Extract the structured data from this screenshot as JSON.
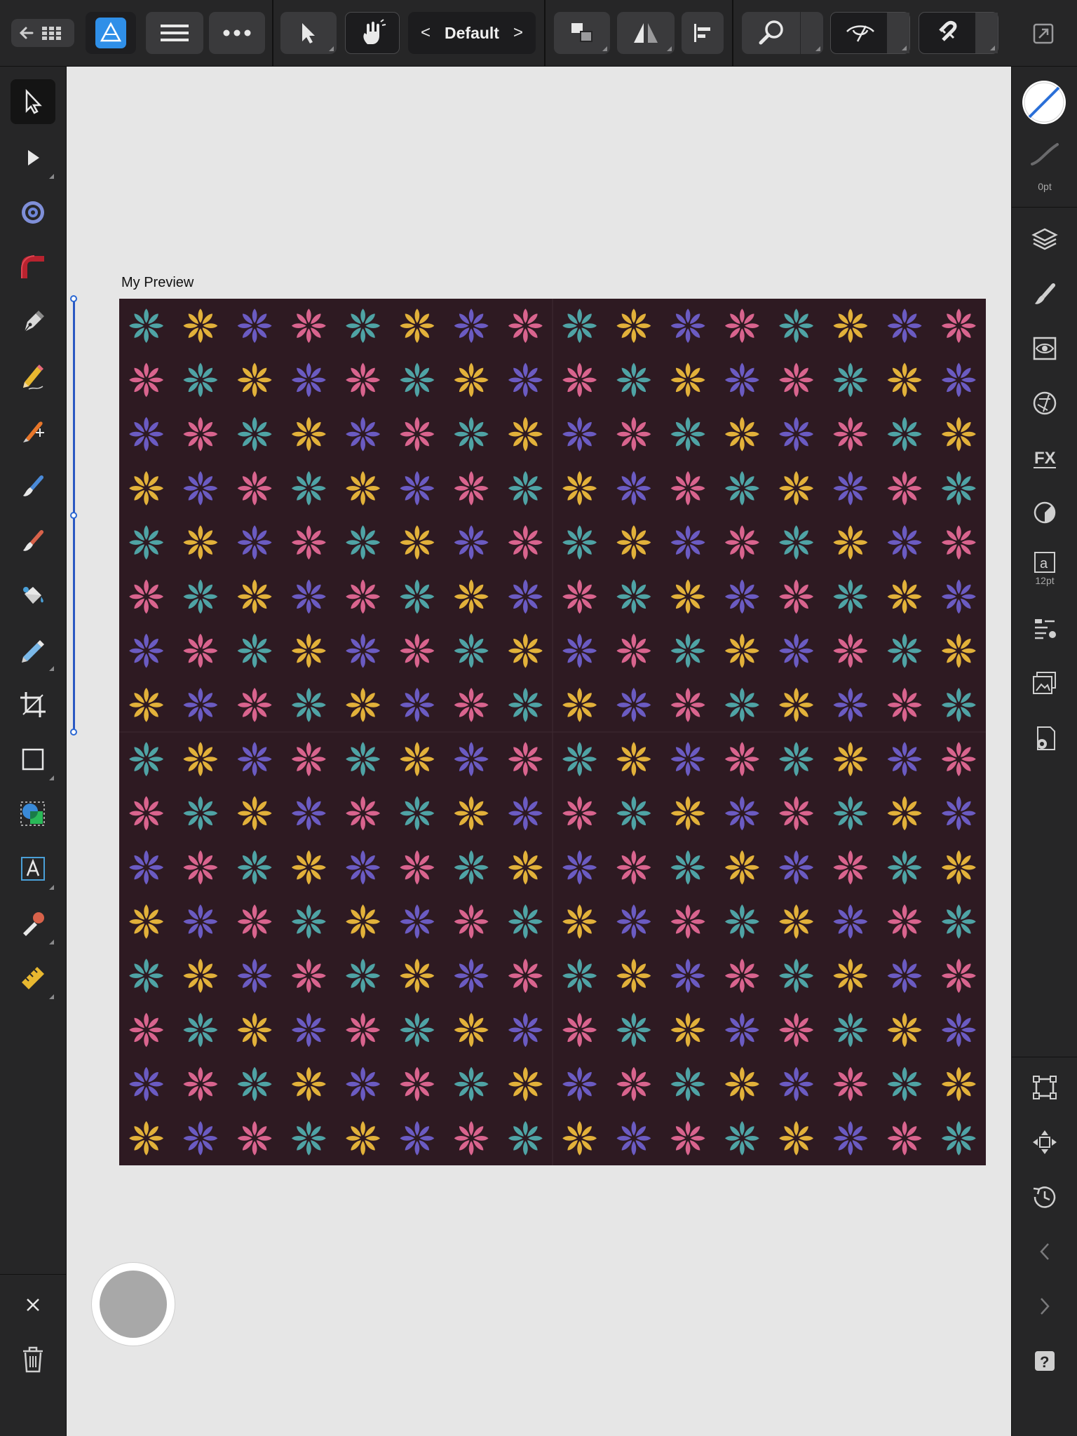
{
  "toolbar": {
    "preset_label": "Default",
    "prev_symbol": "<",
    "next_symbol": ">"
  },
  "artboard": {
    "title": "My Preview"
  },
  "right_panel": {
    "stroke_width": "0pt",
    "text_size": "12pt"
  },
  "pattern": {
    "background": "#2e1a22",
    "colors": [
      "#4fa3a5",
      "#e2b13a",
      "#6b5bc2",
      "#d9648e"
    ],
    "rows": 16,
    "cols": 16
  },
  "icons": {
    "left_tools": [
      "move-tool-icon",
      "node-tool-icon",
      "contour-tool-icon",
      "corner-tool-icon",
      "pen-tool-icon",
      "pencil-tool-icon",
      "vector-brush-icon",
      "paint-brush-icon",
      "pixel-brush-icon",
      "fill-tool-icon",
      "transparency-tool-icon",
      "crop-tool-icon",
      "rectangle-tool-icon",
      "shape-builder-icon",
      "text-tool-icon",
      "color-picker-icon",
      "measure-tool-icon"
    ],
    "right_panels": [
      "layers-icon",
      "brushes-icon",
      "appearance-icon",
      "adjustments-icon",
      "fx-icon",
      "color-icon",
      "text-studio-icon",
      "paragraph-icon",
      "assets-icon",
      "settings-icon"
    ]
  }
}
